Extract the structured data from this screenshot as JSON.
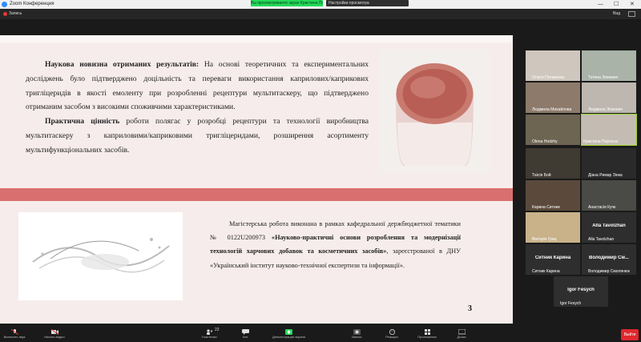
{
  "window": {
    "title": "Zoom Конференция"
  },
  "recording": {
    "label": "Запись"
  },
  "share_banner": {
    "text": "Вы просматриваете экран Кристина Поросна",
    "view_options": "Настройки просмотра"
  },
  "view": {
    "label": "Вид"
  },
  "slide": {
    "p1_bold": "Наукова новизна отриманих результатів:",
    "p1_text": " На основі теоретичних та експериментальних досліджень було підтверджено доцільність та переваги використання каприлових/каприкових тригліцеридів в якості емоленту при розробленні рецептури мультитаскеру, що підтверджено отриманим засобом з високими споживчими характеристиками.",
    "p2_bold": "Практична цінність",
    "p2_text": " роботи полягає у розробці рецептури та технології виробництва мультитаскеру з каприловими/каприковими тригліцеридами, розширення асортименту мультифункціональних засобів.",
    "caption_a": "Магістерська робота виконана в рамках кафедральної держбюджетної тематики № 0122U200973 ",
    "caption_bold": "«Науково-практичні основи розроблення та модернізації технологій харчових добавок та косметичних засобів»",
    "caption_b": ", зареєстрованої в ДНУ «Український інститут науково-технічної експертизи та інформації».",
    "page_number": "3",
    "colors": {
      "accent_band": "#d9706f",
      "background": "#f7ecec"
    }
  },
  "participants": [
    {
      "name": "Олеся Потапенко",
      "type": "video"
    },
    {
      "name": "Тетяна Зінкевич",
      "type": "video"
    },
    {
      "name": "Людмила Михайлова",
      "type": "video"
    },
    {
      "name": "Людмила Зінкевич",
      "type": "video"
    },
    {
      "name": "Olena Hodzhy",
      "type": "video"
    },
    {
      "name": "Кристина Поросна",
      "type": "video",
      "speaking": true
    },
    {
      "name": "Таїсія Бой",
      "type": "video"
    },
    {
      "name": "Діана Римар Зінка",
      "type": "video"
    },
    {
      "name": "Карина Ситник",
      "type": "video"
    },
    {
      "name": "Анастасія Кучк",
      "type": "video"
    },
    {
      "name": "Вікторія Гриц",
      "type": "video"
    },
    {
      "name": "Alla Tavolzhan",
      "type": "name",
      "label": "Alla Tavolzhan"
    },
    {
      "name": "Ситник Карина",
      "type": "name",
      "label": "Ситник Карина"
    },
    {
      "name": "Володимир Смолянюк",
      "type": "name",
      "label": "Володимир См..."
    },
    {
      "name": "Igor Fesych",
      "type": "name",
      "label": "Igor Fesych"
    }
  ],
  "toolbar": {
    "unmute": "Включить звук",
    "start_video": "Начать видео",
    "participants": "Участники",
    "participants_count": "22",
    "chat": "Чат",
    "share": "Демонстрация экрана",
    "record": "Запись",
    "reactions": "Реакции",
    "apps": "Приложения",
    "whiteboards": "Доски",
    "end": "Выйти"
  }
}
